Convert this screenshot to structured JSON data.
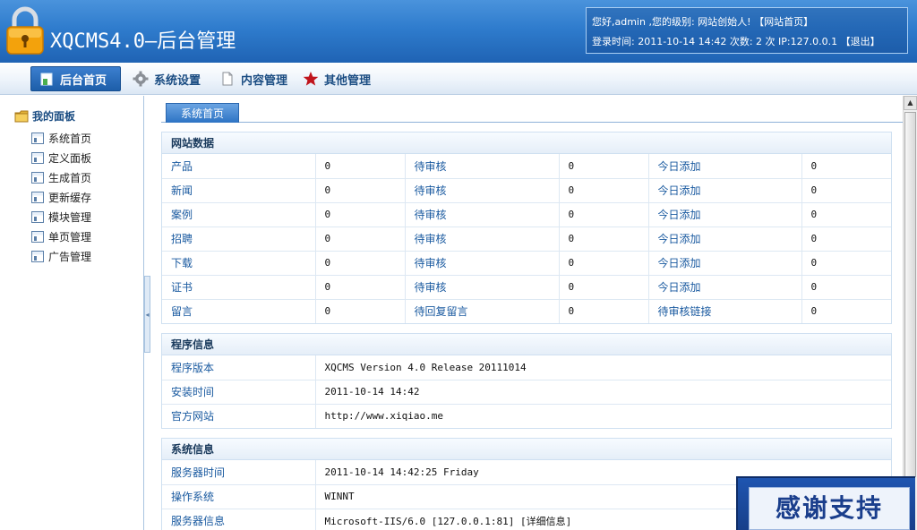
{
  "header": {
    "title": "XQCMS4.0—后台管理",
    "user_line1_prefix": "您好,admin ,您的级别: 网站创始人!",
    "site_home_link": "【网站首页】",
    "user_line2_prefix": "登录时间: 2011-10-14 14:42 次数: 2 次 IP:127.0.0.1",
    "logout_link": "【退出】"
  },
  "nav": {
    "items": [
      {
        "label": "后台首页",
        "icon": "home-icon",
        "active": true
      },
      {
        "label": "系统设置",
        "icon": "gear-icon"
      },
      {
        "label": "内容管理",
        "icon": "document-icon"
      },
      {
        "label": "其他管理",
        "icon": "star-icon"
      }
    ]
  },
  "sidebar": {
    "heading": "我的面板",
    "items": [
      "系统首页",
      "定义面板",
      "生成首页",
      "更新缓存",
      "模块管理",
      "单页管理",
      "广告管理"
    ]
  },
  "main": {
    "tab": "系统首页",
    "site_data": {
      "title": "网站数据",
      "rows": [
        [
          "产品",
          "0",
          "待审核",
          "0",
          "今日添加",
          "0"
        ],
        [
          "新闻",
          "0",
          "待审核",
          "0",
          "今日添加",
          "0"
        ],
        [
          "案例",
          "0",
          "待审核",
          "0",
          "今日添加",
          "0"
        ],
        [
          "招聘",
          "0",
          "待审核",
          "0",
          "今日添加",
          "0"
        ],
        [
          "下载",
          "0",
          "待审核",
          "0",
          "今日添加",
          "0"
        ],
        [
          "证书",
          "0",
          "待审核",
          "0",
          "今日添加",
          "0"
        ],
        [
          "留言",
          "0",
          "待回复留言",
          "0",
          "待审核链接",
          "0"
        ]
      ]
    },
    "program_info": {
      "title": "程序信息",
      "rows": [
        [
          "程序版本",
          "XQCMS Version 4.0 Release 20111014"
        ],
        [
          "安装时间",
          "2011-10-14 14:42"
        ],
        [
          "官方网站",
          "http://www.xiqiao.me"
        ]
      ]
    },
    "system_info": {
      "title": "系统信息",
      "rows": [
        [
          "服务器时间",
          "2011-10-14 14:42:25 Friday"
        ],
        [
          "操作系统",
          "WINNT"
        ],
        [
          "服务器信息",
          "Microsoft-IIS/6.0 [127.0.0.1:81] [详细信息]"
        ]
      ]
    }
  },
  "overlay": {
    "thanks": "感谢支持"
  },
  "colors": {
    "header_blue": "#2f7ccd",
    "nav_active": "#1d5ea9",
    "link_blue": "#1a5aa0",
    "star_red": "#c0141c"
  }
}
